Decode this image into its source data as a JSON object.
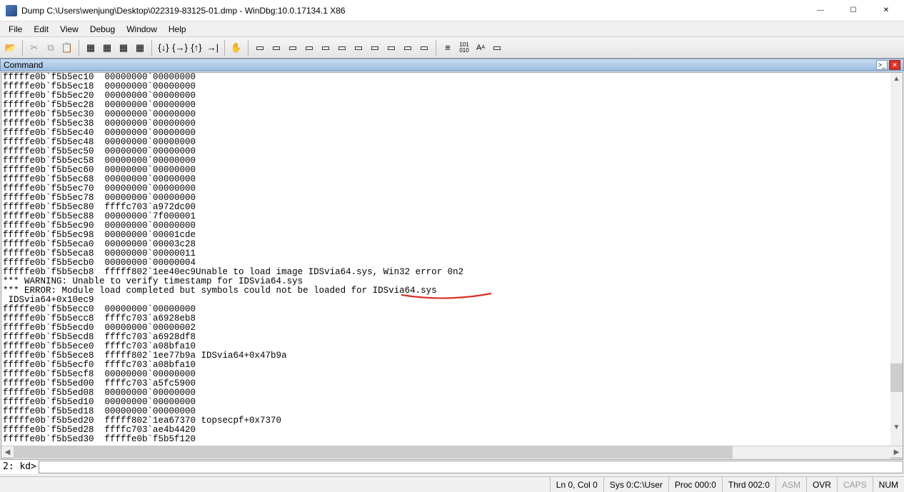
{
  "title": "Dump C:\\Users\\wenjung\\Desktop\\022319-83125-01.dmp - WinDbg:10.0.17134.1 X86",
  "menu": [
    "File",
    "Edit",
    "View",
    "Debug",
    "Window",
    "Help"
  ],
  "pane_title": "Command",
  "prompt": "2: kd>",
  "input_value": "",
  "status": {
    "lncol": "Ln 0, Col 0",
    "sys": "Sys 0:C:\\User",
    "proc": "Proc 000:0",
    "thrd": "Thrd 002:0",
    "asm": "ASM",
    "ovr": "OVR",
    "caps": "CAPS",
    "num": "NUM"
  },
  "output_lines": [
    "fffffe0b`f5b5ec10  00000000`00000000",
    "fffffe0b`f5b5ec18  00000000`00000000",
    "fffffe0b`f5b5ec20  00000000`00000000",
    "fffffe0b`f5b5ec28  00000000`00000000",
    "fffffe0b`f5b5ec30  00000000`00000000",
    "fffffe0b`f5b5ec38  00000000`00000000",
    "fffffe0b`f5b5ec40  00000000`00000000",
    "fffffe0b`f5b5ec48  00000000`00000000",
    "fffffe0b`f5b5ec50  00000000`00000000",
    "fffffe0b`f5b5ec58  00000000`00000000",
    "fffffe0b`f5b5ec60  00000000`00000000",
    "fffffe0b`f5b5ec68  00000000`00000000",
    "fffffe0b`f5b5ec70  00000000`00000000",
    "fffffe0b`f5b5ec78  00000000`00000000",
    "fffffe0b`f5b5ec80  ffffc703`a972dc00",
    "fffffe0b`f5b5ec88  00000000`7f000001",
    "fffffe0b`f5b5ec90  00000000`00000000",
    "fffffe0b`f5b5ec98  00000000`00001cde",
    "fffffe0b`f5b5eca0  00000000`00003c28",
    "fffffe0b`f5b5eca8  00000000`00000011",
    "fffffe0b`f5b5ecb0  00000000`00000004",
    "fffffe0b`f5b5ecb8  fffff802`1ee40ec9Unable to load image IDSvia64.sys, Win32 error 0n2",
    "*** WARNING: Unable to verify timestamp for IDSvia64.sys",
    "*** ERROR: Module load completed but symbols could not be loaded for IDSvia64.sys",
    " IDSvia64+0x10ec9",
    "fffffe0b`f5b5ecc0  00000000`00000000",
    "fffffe0b`f5b5ecc8  ffffc703`a6928eb8",
    "fffffe0b`f5b5ecd0  00000000`00000002",
    "fffffe0b`f5b5ecd8  ffffc703`a6928df8",
    "fffffe0b`f5b5ece0  ffffc703`a08bfa10",
    "fffffe0b`f5b5ece8  fffff802`1ee77b9a IDSvia64+0x47b9a",
    "fffffe0b`f5b5ecf0  ffffc703`a08bfa10",
    "fffffe0b`f5b5ecf8  00000000`00000000",
    "fffffe0b`f5b5ed00  ffffc703`a5fc5900",
    "fffffe0b`f5b5ed08  00000000`00000000",
    "fffffe0b`f5b5ed10  00000000`00000000",
    "fffffe0b`f5b5ed18  00000000`00000000",
    "fffffe0b`f5b5ed20  fffff802`1ea67370 topsecpf+0x7370",
    "fffffe0b`f5b5ed28  ffffc703`ae4b4420",
    "fffffe0b`f5b5ed30  fffffe0b`f5b5f120"
  ],
  "highlight_text": "IDSvia64.sys",
  "highlight_line_index": 23
}
